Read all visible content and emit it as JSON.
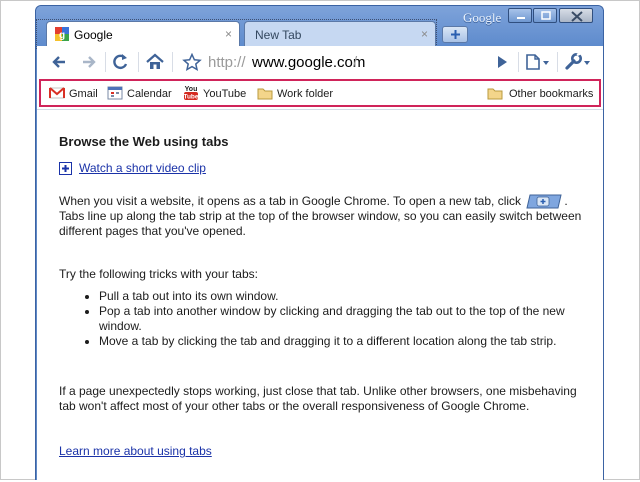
{
  "window": {
    "brand": "Google",
    "colors": {
      "frame": "#5f88c6",
      "link": "#1a32a8",
      "highlight": "#d0245a"
    }
  },
  "tabs": [
    {
      "title": "Google",
      "close": "×",
      "active": true
    },
    {
      "title": "New Tab",
      "close": "×",
      "active": false
    }
  ],
  "omnibox": {
    "scheme": "http://",
    "host": "www.google.com",
    "path": "/"
  },
  "bookmarks": {
    "items": [
      {
        "label": "Gmail",
        "icon": "gmail-icon"
      },
      {
        "label": "Calendar",
        "icon": "calendar-icon"
      },
      {
        "label": "YouTube",
        "icon": "youtube-icon"
      },
      {
        "label": "Work folder",
        "icon": "folder-icon"
      }
    ],
    "other": "Other bookmarks"
  },
  "content": {
    "heading": "Browse the Web using tabs",
    "video_link": "Watch a short video clip",
    "para1_before": "When you visit a website, it opens as a tab in Google Chrome. To open a new tab, click",
    "para1_after": ". Tabs line up along the tab strip at the top of the browser window, so you can easily switch between different pages that you've opened.",
    "para2": "Try the following tricks with your tabs:",
    "tricks": [
      "Pull a tab out into its own window.",
      "Pop a tab into another window by clicking and dragging the tab out to the top of the new window.",
      "Move a tab by clicking the tab and dragging it to a different location along the tab strip."
    ],
    "para3": "If a page unexpectedly stops working, just close that tab. Unlike other browsers, one misbehaving tab won't affect most of your other tabs or the overall responsiveness of Google Chrome.",
    "learn_more": "Learn more about using tabs"
  }
}
